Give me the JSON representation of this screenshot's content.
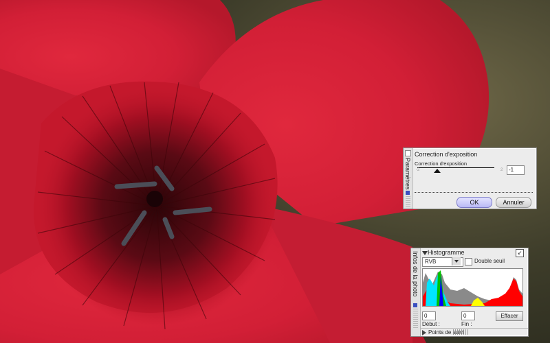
{
  "photo": {
    "subject": "red-flower-macro"
  },
  "exposure_panel": {
    "tab_label": "Paramètres",
    "title": "Correction d'exposition",
    "slider_label": "Correction d'exposition",
    "tick_min": "-2",
    "tick_max": "2",
    "value": "-1",
    "ok_label": "OK",
    "cancel_label": "Annuler"
  },
  "histogram_panel": {
    "tab_label": "Infos de la photo",
    "title": "Histogramme",
    "channel_selected": "RVB",
    "double_threshold_label": "Double seuil",
    "start_value": "0",
    "end_value": "0",
    "start_label": "Début :",
    "end_label": "Fin :",
    "clear_label": "Effacer",
    "tracking_points_label": "Points de suivi"
  },
  "colors": {
    "petal": "#cc1f35",
    "ok_button": "#c5c5f7",
    "hist_gray": "#8a8a8a",
    "hist_red": "#ff0000",
    "hist_cyan": "#00e5ff",
    "hist_green": "#00c000",
    "hist_blue": "#0000ff"
  }
}
